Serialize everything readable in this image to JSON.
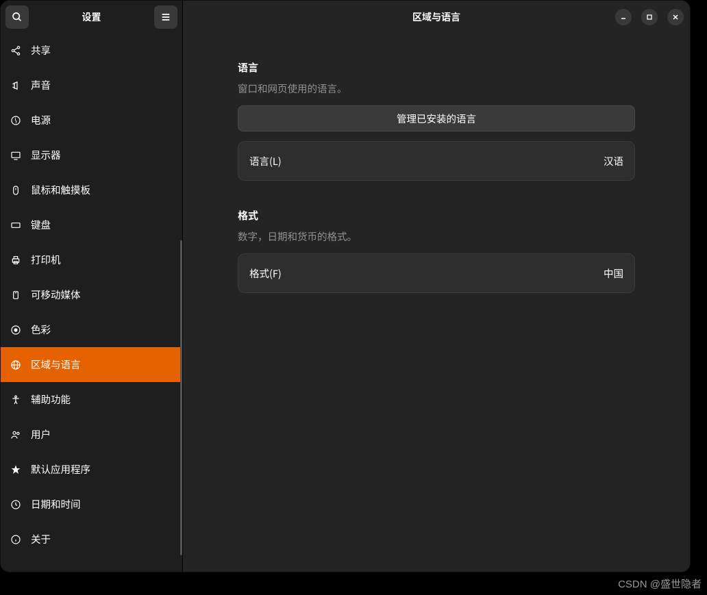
{
  "sidebar": {
    "title": "设置",
    "items": [
      {
        "label": "共享",
        "icon": "share"
      },
      {
        "label": "声音",
        "icon": "sound"
      },
      {
        "label": "电源",
        "icon": "power"
      },
      {
        "label": "显示器",
        "icon": "display"
      },
      {
        "label": "鼠标和触摸板",
        "icon": "mouse"
      },
      {
        "label": "键盘",
        "icon": "keyboard"
      },
      {
        "label": "打印机",
        "icon": "printer"
      },
      {
        "label": "可移动媒体",
        "icon": "media"
      },
      {
        "label": "色彩",
        "icon": "color"
      },
      {
        "label": "区域与语言",
        "icon": "globe",
        "active": true
      },
      {
        "label": "辅助功能",
        "icon": "accessibility"
      },
      {
        "label": "用户",
        "icon": "users"
      },
      {
        "label": "默认应用程序",
        "icon": "star"
      },
      {
        "label": "日期和时间",
        "icon": "clock"
      },
      {
        "label": "关于",
        "icon": "info"
      }
    ]
  },
  "header": {
    "title": "区域与语言"
  },
  "sections": {
    "language": {
      "title": "语言",
      "desc": "窗口和网页使用的语言。",
      "manage_button": "管理已安装的语言",
      "row_label": "语言(L)",
      "row_value": "汉语"
    },
    "format": {
      "title": "格式",
      "desc": "数字，日期和货币的格式。",
      "row_label": "格式(F)",
      "row_value": "中国"
    }
  },
  "watermark": "CSDN @盛世隐者"
}
